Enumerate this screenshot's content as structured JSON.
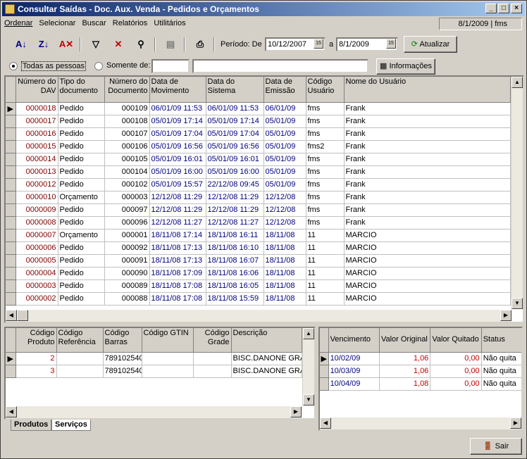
{
  "window": {
    "title": "Consultar Saídas - Doc. Aux. Venda - Pedidos e Orçamentos",
    "min": "_",
    "max": "□",
    "close": "×"
  },
  "menu": [
    "Ordenar",
    "Selecionar",
    "Buscar",
    "Relatórios",
    "Utilitários"
  ],
  "status_date": "8/1/2009 | fms",
  "toolbar": {
    "periodo_label": "Período: De",
    "date_from": "10/12/2007",
    "a_label": "a",
    "date_to": "8/1/2009",
    "atualizar": "Atualizar"
  },
  "filter": {
    "todas": "Todas as pessoas",
    "somente": "Somente de:",
    "code_value": "",
    "name_value": "",
    "informacoes": "Informações"
  },
  "main_grid": {
    "headers": [
      "Número do DAV",
      "Tipo do documento",
      "Número do Documento",
      "Data de Movimento",
      "Data do Sistema",
      "Data de Emissão",
      "Código Usuário",
      "Nome do Usuário"
    ],
    "rows": [
      [
        "0000018",
        "Pedido",
        "000109",
        "06/01/09 11:53",
        "06/01/09 11:53",
        "06/01/09",
        "fms",
        "Frank"
      ],
      [
        "0000017",
        "Pedido",
        "000108",
        "05/01/09 17:14",
        "05/01/09 17:14",
        "05/01/09",
        "fms",
        "Frank"
      ],
      [
        "0000016",
        "Pedido",
        "000107",
        "05/01/09 17:04",
        "05/01/09 17:04",
        "05/01/09",
        "fms",
        "Frank"
      ],
      [
        "0000015",
        "Pedido",
        "000106",
        "05/01/09 16:56",
        "05/01/09 16:56",
        "05/01/09",
        "fms2",
        "Frank"
      ],
      [
        "0000014",
        "Pedido",
        "000105",
        "05/01/09 16:01",
        "05/01/09 16:01",
        "05/01/09",
        "fms",
        "Frank"
      ],
      [
        "0000013",
        "Pedido",
        "000104",
        "05/01/09 16:00",
        "05/01/09 16:00",
        "05/01/09",
        "fms",
        "Frank"
      ],
      [
        "0000012",
        "Pedido",
        "000102",
        "05/01/09 15:57",
        "22/12/08 09:45",
        "05/01/09",
        "fms",
        "Frank"
      ],
      [
        "0000010",
        "Orçamento",
        "000003",
        "12/12/08 11:29",
        "12/12/08 11:29",
        "12/12/08",
        "fms",
        "Frank"
      ],
      [
        "0000009",
        "Pedido",
        "000097",
        "12/12/08 11:29",
        "12/12/08 11:29",
        "12/12/08",
        "fms",
        "Frank"
      ],
      [
        "0000008",
        "Pedido",
        "000096",
        "12/12/08 11:27",
        "12/12/08 11:27",
        "12/12/08",
        "fms",
        "Frank"
      ],
      [
        "0000007",
        "Orçamento",
        "000001",
        "18/11/08 17:14",
        "18/11/08 16:11",
        "18/11/08",
        "11",
        "MARCIO"
      ],
      [
        "0000006",
        "Pedido",
        "000092",
        "18/11/08 17:13",
        "18/11/08 16:10",
        "18/11/08",
        "11",
        "MARCIO"
      ],
      [
        "0000005",
        "Pedido",
        "000091",
        "18/11/08 17:13",
        "18/11/08 16:07",
        "18/11/08",
        "11",
        "MARCIO"
      ],
      [
        "0000004",
        "Pedido",
        "000090",
        "18/11/08 17:09",
        "18/11/08 16:06",
        "18/11/08",
        "11",
        "MARCIO"
      ],
      [
        "0000003",
        "Pedido",
        "000089",
        "18/11/08 17:08",
        "18/11/08 16:05",
        "18/11/08",
        "11",
        "MARCIO"
      ],
      [
        "0000002",
        "Pedido",
        "000088",
        "18/11/08 17:08",
        "18/11/08 15:59",
        "18/11/08",
        "11",
        "MARCIO"
      ]
    ]
  },
  "products_grid": {
    "headers": [
      "Código Produto",
      "Código Referência",
      "Código Barras",
      "Código GTIN",
      "Código Grade",
      "Descrição"
    ],
    "rows": [
      [
        "2",
        "",
        "789102540",
        "",
        "",
        "BISC.DANONE GRA"
      ],
      [
        "3",
        "",
        "789102540",
        "",
        "",
        "BISC.DANONE GRA"
      ]
    ]
  },
  "tabs": [
    "Produtos",
    "Serviços"
  ],
  "installments_grid": {
    "headers": [
      "Vencimento",
      "Valor Original",
      "Valor Quitado",
      "Status"
    ],
    "rows": [
      [
        "10/02/09",
        "1,06",
        "0,00",
        "Não quita"
      ],
      [
        "10/03/09",
        "1,06",
        "0,00",
        "Não quita"
      ],
      [
        "10/04/09",
        "1,08",
        "0,00",
        "Não quita"
      ]
    ]
  },
  "sair": "Sair",
  "colors": {
    "title_start": "#0a246a",
    "title_end": "#a6caf0",
    "dav": "#800000",
    "date": "#000080",
    "money": "#c00000"
  }
}
